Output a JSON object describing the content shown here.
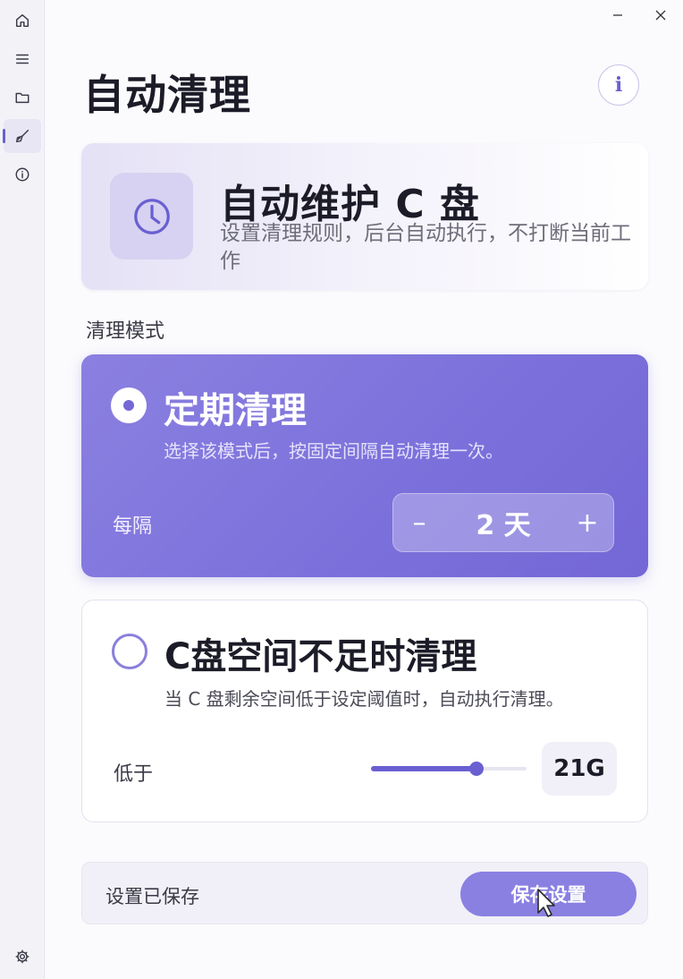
{
  "window": {
    "minimize_icon": "minimize-icon",
    "close_icon": "close-icon"
  },
  "sidebar": {
    "items": [
      {
        "name": "home",
        "icon": "home-icon",
        "active": false
      },
      {
        "name": "menu",
        "icon": "menu-icon",
        "active": false
      },
      {
        "name": "files",
        "icon": "folder-icon",
        "active": false
      },
      {
        "name": "clean",
        "icon": "broom-icon",
        "active": true
      },
      {
        "name": "about",
        "icon": "info-icon",
        "active": false
      }
    ],
    "settings_icon": "gear-icon"
  },
  "header": {
    "title": "自动清理",
    "info_glyph": "i"
  },
  "hero": {
    "title": "自动维护 C 盘",
    "description": "设置清理规则，后台自动执行，不打断当前工作",
    "icon": "clock-icon"
  },
  "mode_section": {
    "label": "清理模式"
  },
  "modes": {
    "periodic": {
      "title": "定期清理",
      "description": "选择该模式后，按固定间隔自动清理一次。",
      "row_label": "每隔",
      "minus": "–",
      "value": "2 天",
      "plus": "+",
      "selected": true
    },
    "low_space": {
      "title": "C盘空间不足时清理",
      "description": "当 C 盘剩余空间低于设定阈值时，自动执行清理。",
      "row_label": "低于",
      "threshold": "21G",
      "slider_fraction": 0.68,
      "selected": false
    }
  },
  "footer": {
    "status": "设置已保存",
    "save_label": "保存设置"
  },
  "colors": {
    "accent": "#6a5fd1",
    "card_selected": "#7b70db",
    "save_button": "#8a80e2"
  }
}
